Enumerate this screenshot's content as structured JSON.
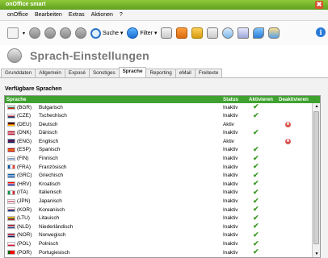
{
  "window": {
    "title": "onOffice smart",
    "close_icon": "close-icon"
  },
  "menu": [
    "onOffice",
    "Bearbeiten",
    "Extras",
    "Aktionen",
    "?"
  ],
  "toolbar": {
    "search_label": "Suche",
    "filter_label": "Filter",
    "dropdown_arrow": "▾",
    "info_glyph": "i"
  },
  "header": {
    "title": "Sprach-Einstellungen"
  },
  "tabs": [
    {
      "label": "Grunddaten"
    },
    {
      "label": "Allgemein"
    },
    {
      "label": "Exposé"
    },
    {
      "label": "Sonstiges"
    },
    {
      "label": "Sprache",
      "active": true
    },
    {
      "label": "Reporting"
    },
    {
      "label": "eMail"
    },
    {
      "label": "Freitexte"
    }
  ],
  "section": {
    "title": "Verfügbare Sprachen"
  },
  "grid": {
    "columns": {
      "name": "Sprache",
      "status": "Status",
      "activate": "Aktivieren",
      "deactivate": "Deaktivieren"
    },
    "rows": [
      {
        "code": "(BGR)",
        "name": "Bulgarisch",
        "status": "Inaktiv",
        "action": "activate",
        "flag": [
          "#ffffff",
          "#00966e",
          "#d62612"
        ]
      },
      {
        "code": "(CZE)",
        "name": "Tschechisch",
        "status": "Inaktiv",
        "action": "activate",
        "flag": [
          "#ffffff",
          "#d7141a",
          "#11457e"
        ]
      },
      {
        "code": "(DEU)",
        "name": "Deutsch",
        "status": "Aktiv",
        "action": "deactivate",
        "flag": [
          "#000000",
          "#dd0000",
          "#ffce00"
        ]
      },
      {
        "code": "(DNK)",
        "name": "Dänisch",
        "status": "Inaktiv",
        "action": "activate",
        "flag": [
          "#c60c30",
          "#ffffff",
          "#c60c30"
        ]
      },
      {
        "code": "(ENG)",
        "name": "Englisch",
        "status": "Aktiv",
        "action": "deactivate",
        "flag": [
          "#012169",
          "#c8102e",
          "#012169"
        ]
      },
      {
        "code": "(ESP)",
        "name": "Spanisch",
        "status": "Inaktiv",
        "action": "activate",
        "flag": [
          "#c60b1e",
          "#ffc400",
          "#c60b1e"
        ]
      },
      {
        "code": "(FIN)",
        "name": "Finnisch",
        "status": "Inaktiv",
        "action": "activate",
        "flag": [
          "#ffffff",
          "#003580",
          "#ffffff"
        ]
      },
      {
        "code": "(FRA)",
        "name": "Französisch",
        "status": "Inaktiv",
        "action": "activate",
        "flag": [
          "#0055a4",
          "#ffffff",
          "#ef4135"
        ],
        "vertical": true
      },
      {
        "code": "(GRC)",
        "name": "Griechisch",
        "status": "Inaktiv",
        "action": "activate",
        "flag": [
          "#0d5eaf",
          "#ffffff",
          "#0d5eaf"
        ]
      },
      {
        "code": "(HRV)",
        "name": "Kroatisch",
        "status": "Inaktiv",
        "action": "activate",
        "flag": [
          "#ff0000",
          "#ffffff",
          "#171796"
        ]
      },
      {
        "code": "(ITA)",
        "name": "Italienisch",
        "status": "Inaktiv",
        "action": "activate",
        "flag": [
          "#009246",
          "#ffffff",
          "#ce2b37"
        ],
        "vertical": true
      },
      {
        "code": "(JPN)",
        "name": "Japanisch",
        "status": "Inaktiv",
        "action": "activate",
        "flag": [
          "#ffffff",
          "#bc002d",
          "#ffffff"
        ]
      },
      {
        "code": "(KOR)",
        "name": "Koreanisch",
        "status": "Inaktiv",
        "action": "activate",
        "flag": [
          "#ffffff",
          "#cd2e3a",
          "#0047a0"
        ]
      },
      {
        "code": "(LTU)",
        "name": "Litauisch",
        "status": "Inaktiv",
        "action": "activate",
        "flag": [
          "#fdb913",
          "#006a44",
          "#c1272d"
        ]
      },
      {
        "code": "(NLD)",
        "name": "Niederländisch",
        "status": "Inaktiv",
        "action": "activate",
        "flag": [
          "#ae1c28",
          "#ffffff",
          "#21468b"
        ]
      },
      {
        "code": "(NOR)",
        "name": "Norwegisch",
        "status": "Inaktiv",
        "action": "activate",
        "flag": [
          "#ba0c2f",
          "#ffffff",
          "#00205b"
        ]
      },
      {
        "code": "(POL)",
        "name": "Polnisch",
        "status": "Inaktiv",
        "action": "activate",
        "flag": [
          "#ffffff",
          "#ffffff",
          "#dc143c"
        ]
      },
      {
        "code": "(POR)",
        "name": "Portugiesisch",
        "status": "Inaktiv",
        "action": "activate",
        "flag": [
          "#006600",
          "#ff0000",
          "#ff0000"
        ],
        "vertical": true
      }
    ]
  },
  "glyphs": {
    "check": "✔",
    "delete": "✖",
    "scroll_up": "▲",
    "scroll_down": "▼"
  },
  "colors": {
    "accent_green": "#3fa12f",
    "title_green": "#6fb12a",
    "status_delete": "#d9534f"
  }
}
